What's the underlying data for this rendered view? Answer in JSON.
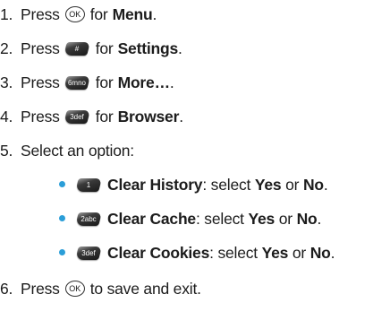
{
  "steps": [
    {
      "num": "1.",
      "pre": "Press",
      "key": "OK",
      "mid": "for",
      "bold": "Menu",
      "post": "."
    },
    {
      "num": "2.",
      "pre": "Press",
      "key": "#",
      "mid": "for",
      "bold": "Settings",
      "post": "."
    },
    {
      "num": "3.",
      "pre": "Press",
      "key": "6mno",
      "mid": "for",
      "bold": "More…",
      "post": "."
    },
    {
      "num": "4.",
      "pre": "Press",
      "key": "3def",
      "mid": "for",
      "bold": "Browser",
      "post": "."
    },
    {
      "num": "5.",
      "text": "Select an option:"
    },
    {
      "num": "6.",
      "pre": "Press",
      "key": "OK",
      "post": "to save and exit."
    }
  ],
  "options": [
    {
      "key": "1",
      "name": "Clear History",
      "text1": ": select ",
      "yes": "Yes",
      "or": " or ",
      "no": "No",
      "end": "."
    },
    {
      "key": "2abc",
      "name": "Clear Cache",
      "text1": ": select ",
      "yes": "Yes",
      "or": " or ",
      "no": "No",
      "end": "."
    },
    {
      "key": "3def",
      "name": "Clear Cookies",
      "text1": ": select ",
      "yes": "Yes",
      "or": " or ",
      "no": "No",
      "end": "."
    }
  ],
  "colors": {
    "bullet": "#2b9ed8",
    "text": "#1c1c1c"
  }
}
